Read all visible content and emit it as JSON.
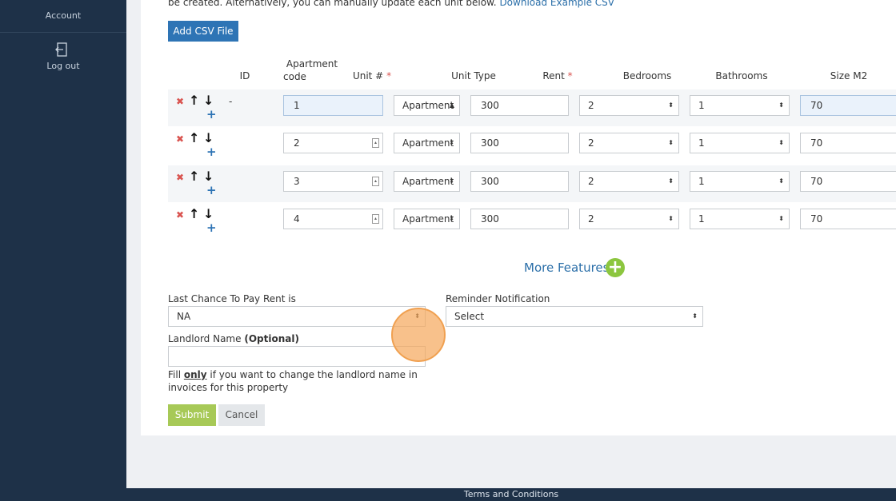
{
  "sidebar": {
    "account_label": "Account",
    "logout_label": "Log out"
  },
  "intro": {
    "text": "be created. Alternatively, you can manually update each unit below.",
    "link": "Download Example CSV"
  },
  "csv_button": "Add CSV File",
  "table": {
    "headers": {
      "id": "ID",
      "apartment_code_1": "Apartment",
      "apartment_code_2": "code",
      "unit": "Unit #",
      "unit_type": "Unit Type",
      "rent": "Rent",
      "bedrooms": "Bedrooms",
      "bathrooms": "Bathrooms",
      "size": "Size M2"
    },
    "required_mark": "*",
    "rows": [
      {
        "id": "-",
        "unit": "1",
        "unit_type": "Apartment",
        "rent": "300",
        "bedrooms": "2",
        "bathrooms": "1",
        "size": "70"
      },
      {
        "id": "",
        "unit": "2",
        "unit_type": "Apartment",
        "rent": "300",
        "bedrooms": "2",
        "bathrooms": "1",
        "size": "70"
      },
      {
        "id": "",
        "unit": "3",
        "unit_type": "Apartment",
        "rent": "300",
        "bedrooms": "2",
        "bathrooms": "1",
        "size": "70"
      },
      {
        "id": "",
        "unit": "4",
        "unit_type": "Apartment",
        "rent": "300",
        "bedrooms": "2",
        "bathrooms": "1",
        "size": "70"
      }
    ]
  },
  "more_features": "More Features",
  "last_chance": {
    "label": "Last Chance To Pay Rent is",
    "value": "NA"
  },
  "reminder": {
    "label": "Reminder Notification",
    "value": "Select"
  },
  "landlord": {
    "label": "Landlord Name",
    "optional": "(Optional)",
    "value": "",
    "help_1": "Fill",
    "help_bold": "only",
    "help_2": "if you want to change the landlord name in",
    "help_3": "invoices for this property"
  },
  "buttons": {
    "submit": "Submit",
    "cancel": "Cancel"
  },
  "footer": {
    "terms": "Terms and Conditions"
  },
  "icons": {
    "remove": "x-icon",
    "move_up": "arrow-up-icon",
    "move_down": "arrow-down-icon",
    "add": "plus-icon"
  }
}
